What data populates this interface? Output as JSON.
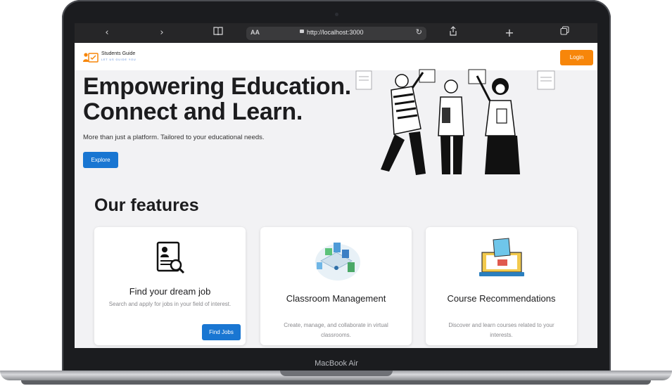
{
  "device": {
    "label": "MacBook Air"
  },
  "browser": {
    "back_icon": "chevron-left-icon",
    "forward_icon": "chevron-right-icon",
    "reader_text_size": "AA",
    "url": "http://localhost:3000",
    "tabs_icon": "tabs-icon"
  },
  "site": {
    "logo_title": "Students Guide",
    "logo_tagline": "LET US GUIDE YOU",
    "login_label": "Login",
    "brand_color": "#f7860a",
    "accent_color": "#1976d2"
  },
  "hero": {
    "title_line1": "Empowering Education.",
    "title_line2": "Connect and Learn.",
    "subtitle": "More than just a platform. Tailored to your educational needs.",
    "explore_label": "Explore"
  },
  "features": {
    "heading": "Our features",
    "cards": [
      {
        "title": "Find your dream job",
        "description": "Search and apply for jobs in your field of interest.",
        "button": "Find Jobs",
        "icon": "resume-search-icon"
      },
      {
        "title": "Classroom Management",
        "description": "Create, manage, and collaborate in virtual classrooms.",
        "icon": "classroom-isometric-icon"
      },
      {
        "title": "Course Recommendations",
        "description": "Discover and learn courses related to your interests.",
        "icon": "laptop-hand-icon"
      }
    ]
  }
}
